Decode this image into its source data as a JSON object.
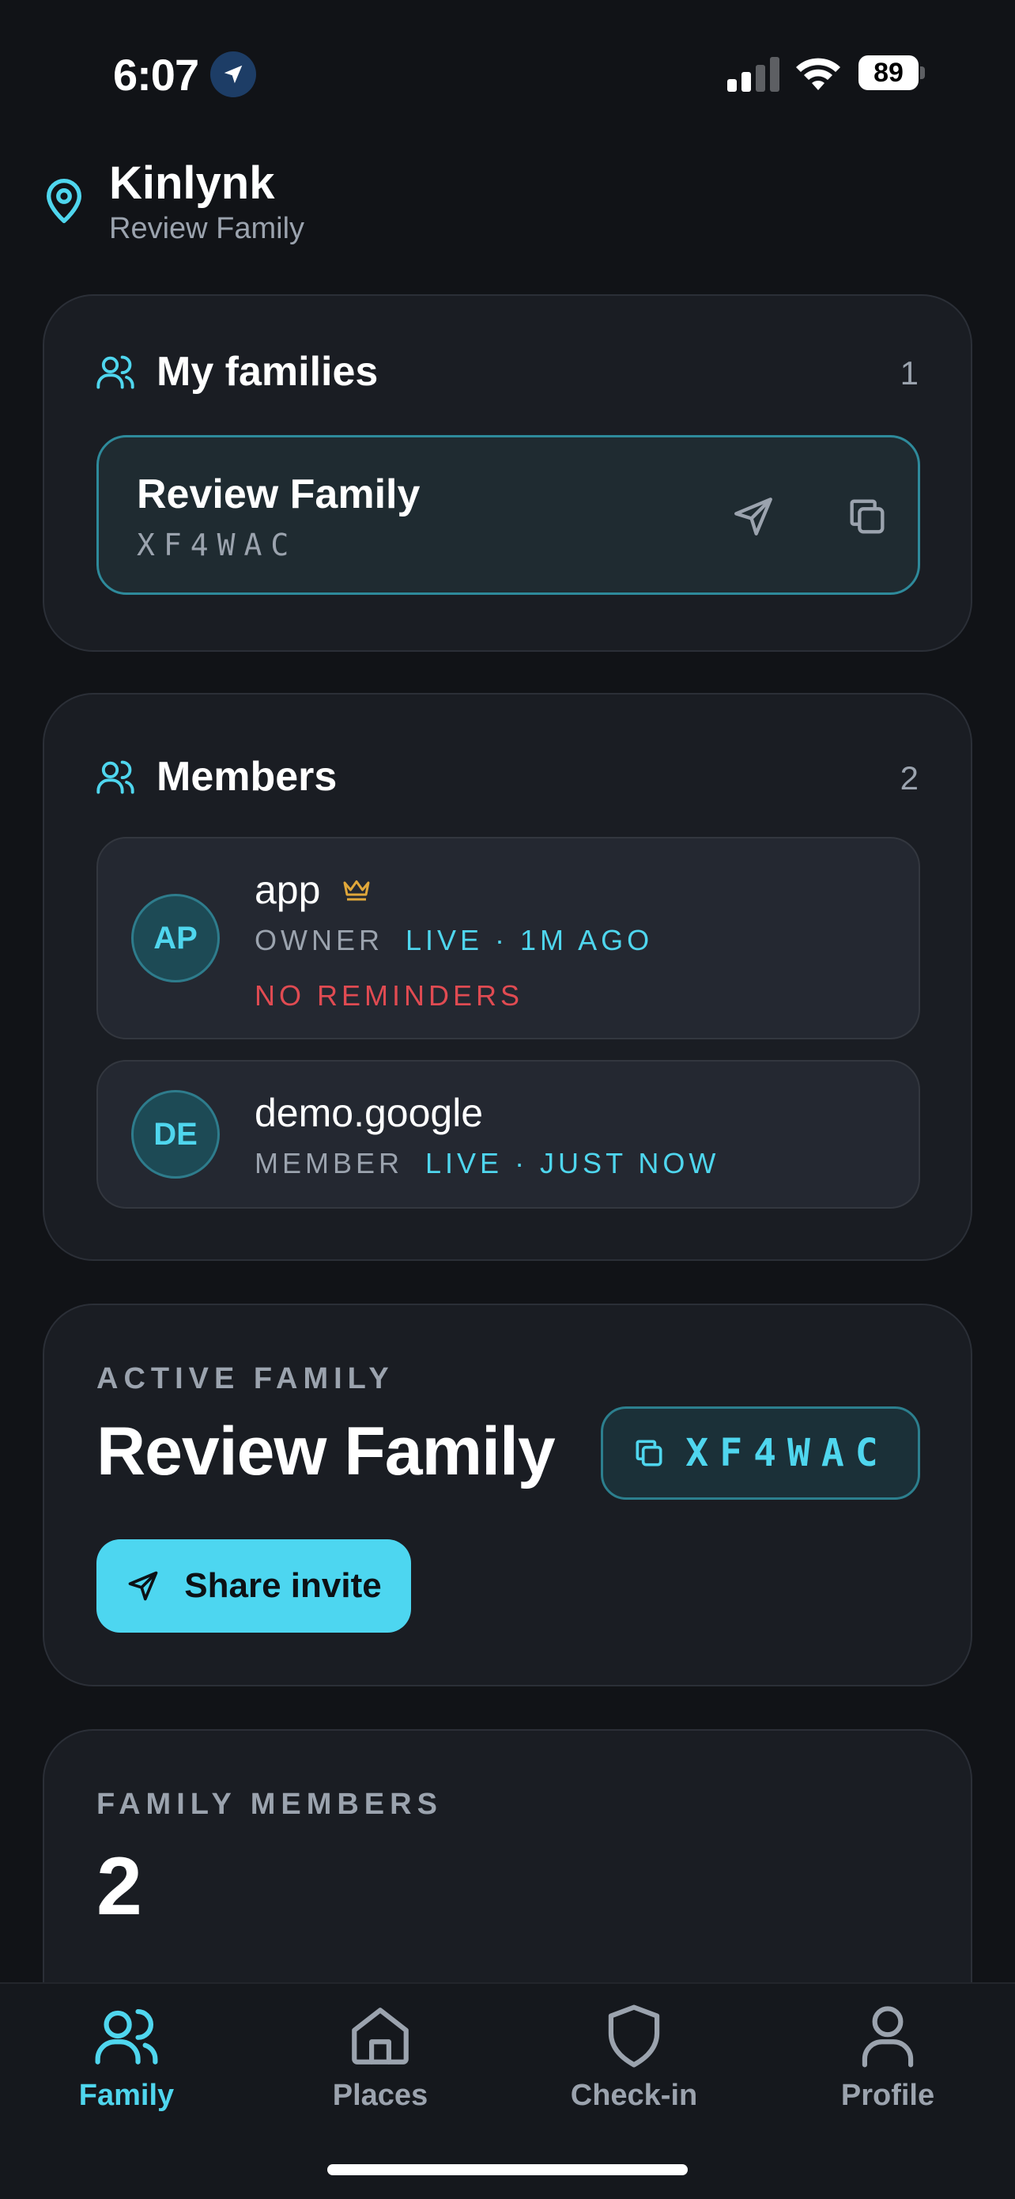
{
  "status_bar": {
    "time": "6:07",
    "battery": "89"
  },
  "header": {
    "app_name": "Kinlynk",
    "subtitle": "Review Family"
  },
  "my_families": {
    "title": "My families",
    "count": "1",
    "families": [
      {
        "name": "Review Family",
        "code": "XF4WAC"
      }
    ]
  },
  "members": {
    "title": "Members",
    "count": "2",
    "items": [
      {
        "initials": "AP",
        "name": "app",
        "role": "OWNER",
        "status": "LIVE · 1M AGO",
        "note": "NO REMINDERS"
      },
      {
        "initials": "DE",
        "name": "demo.google",
        "role": "MEMBER",
        "status": "LIVE · JUST NOW"
      }
    ]
  },
  "active_family": {
    "eyebrow": "ACTIVE FAMILY",
    "name": "Review Family",
    "code": "XF4WAC",
    "share_label": "Share invite"
  },
  "family_members_stat": {
    "eyebrow": "FAMILY MEMBERS",
    "value": "2"
  },
  "tabs": [
    {
      "label": "Family",
      "icon": "users-icon",
      "active": true
    },
    {
      "label": "Places",
      "icon": "home-icon",
      "active": false
    },
    {
      "label": "Check-in",
      "icon": "shield-icon",
      "active": false
    },
    {
      "label": "Profile",
      "icon": "user-icon",
      "active": false
    }
  ],
  "colors": {
    "accent": "#4fd6ee",
    "background": "#111317",
    "card": "#1a1d23",
    "warning": "#e04b52",
    "owner_crown": "#e0a73a"
  }
}
